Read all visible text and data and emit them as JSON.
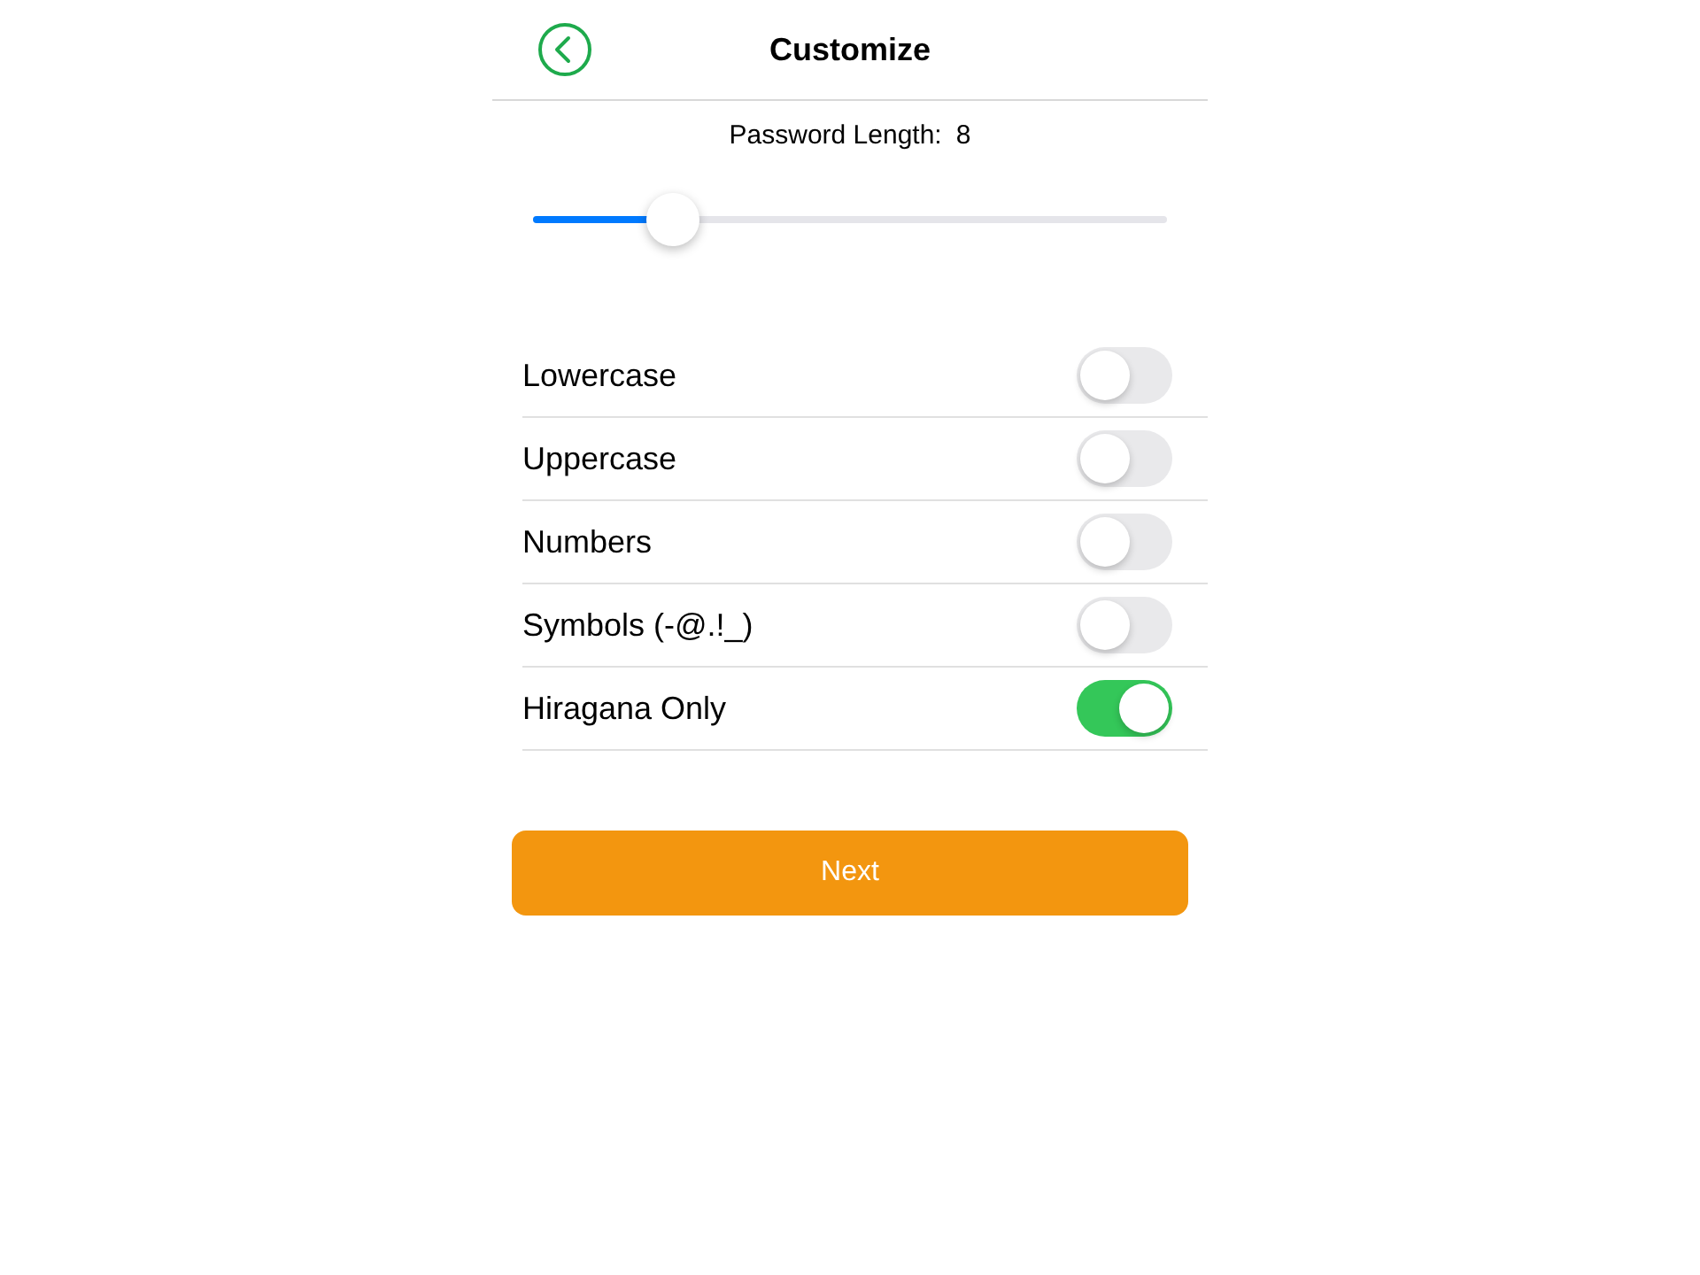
{
  "header": {
    "title": "Customize"
  },
  "password_length": {
    "label": "Password Length:",
    "value": "8",
    "level": 0.22
  },
  "options": [
    {
      "label": "Lowercase",
      "on": false
    },
    {
      "label": "Uppercase",
      "on": false
    },
    {
      "label": "Numbers",
      "on": false
    },
    {
      "label": "Symbols (-@.!_)",
      "on": false
    },
    {
      "label": "Hiragana Only",
      "on": true
    }
  ],
  "next_button": {
    "label": "Next"
  }
}
